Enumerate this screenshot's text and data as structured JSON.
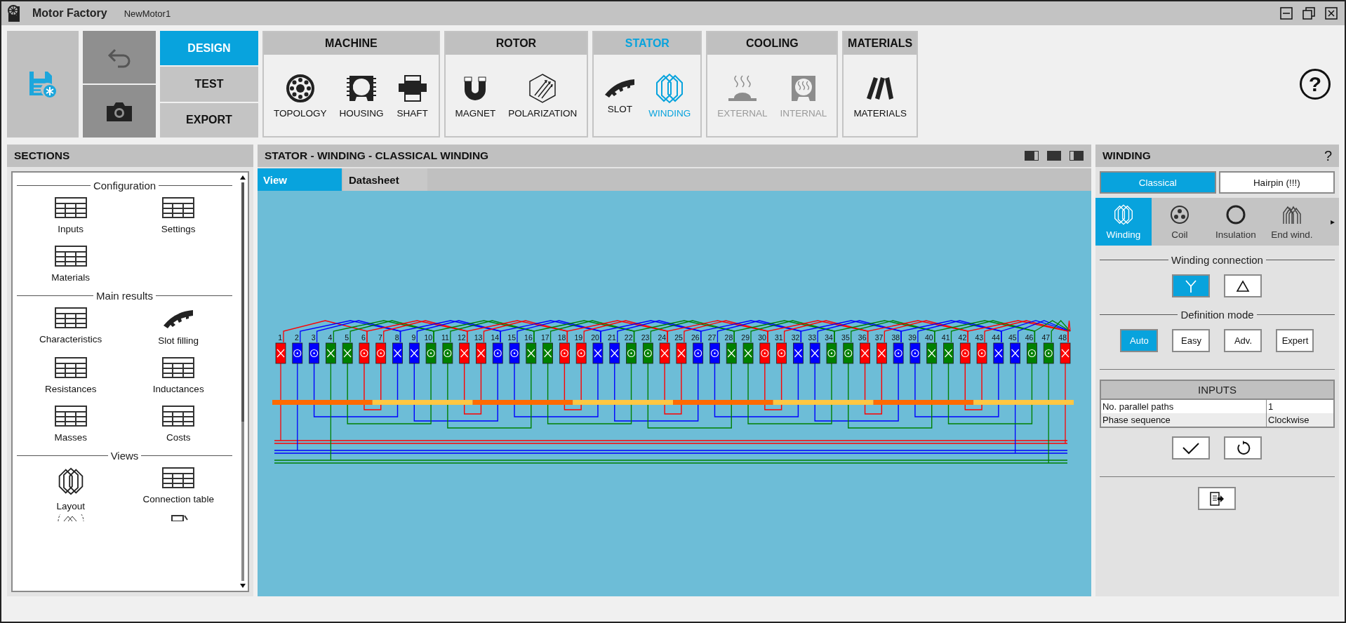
{
  "window": {
    "app_title": "Motor Factory",
    "document": "NewMotor1"
  },
  "mode_buttons": [
    {
      "label": "DESIGN",
      "selected": true
    },
    {
      "label": "TEST",
      "selected": false
    },
    {
      "label": "EXPORT",
      "selected": false
    }
  ],
  "ribbon_groups": [
    {
      "title": "MACHINE",
      "selected": false,
      "items": [
        {
          "label": "TOPOLOGY",
          "kind": "topology",
          "disabled": false,
          "selected": false
        },
        {
          "label": "HOUSING",
          "kind": "housing",
          "disabled": false,
          "selected": false
        },
        {
          "label": "SHAFT",
          "kind": "shaft",
          "disabled": false,
          "selected": false
        }
      ]
    },
    {
      "title": "ROTOR",
      "selected": false,
      "items": [
        {
          "label": "MAGNET",
          "kind": "magnet",
          "disabled": false,
          "selected": false
        },
        {
          "label": "POLARIZATION",
          "kind": "polarization",
          "disabled": false,
          "selected": false
        }
      ]
    },
    {
      "title": "STATOR",
      "selected": true,
      "items": [
        {
          "label": "SLOT",
          "kind": "slot",
          "disabled": false,
          "selected": false
        },
        {
          "label": "WINDING",
          "kind": "winding",
          "disabled": false,
          "selected": true
        }
      ]
    },
    {
      "title": "COOLING",
      "selected": false,
      "items": [
        {
          "label": "EXTERNAL",
          "kind": "external",
          "disabled": true,
          "selected": false
        },
        {
          "label": "INTERNAL",
          "kind": "internal",
          "disabled": true,
          "selected": false
        }
      ]
    },
    {
      "title": "MATERIALS",
      "selected": false,
      "items": [
        {
          "label": "MATERIALS",
          "kind": "materials",
          "disabled": false,
          "selected": false
        }
      ]
    }
  ],
  "help_label": "?",
  "sections": {
    "title": "SECTIONS",
    "groups": [
      {
        "heading": "Configuration",
        "items": [
          {
            "label": "Inputs",
            "kind": "table"
          },
          {
            "label": "Settings",
            "kind": "table"
          },
          {
            "label": "Materials",
            "kind": "table"
          }
        ]
      },
      {
        "heading": "Main results",
        "items": [
          {
            "label": "Characteristics",
            "kind": "table"
          },
          {
            "label": "Slot filling",
            "kind": "slot"
          },
          {
            "label": "Resistances",
            "kind": "table"
          },
          {
            "label": "Inductances",
            "kind": "table"
          },
          {
            "label": "Masses",
            "kind": "table"
          },
          {
            "label": "Costs",
            "kind": "table"
          }
        ]
      },
      {
        "heading": "Views",
        "items": [
          {
            "label": "Layout",
            "kind": "layout"
          },
          {
            "label": "Connection table",
            "kind": "table"
          }
        ]
      }
    ]
  },
  "center": {
    "title": "STATOR - WINDING - CLASSICAL WINDING",
    "tabs": [
      {
        "label": "View",
        "selected": true
      },
      {
        "label": "Datasheet",
        "selected": false
      }
    ],
    "slots": [
      {
        "number": "1",
        "color": "#ff0000",
        "kind": "cross"
      },
      {
        "number": "2",
        "color": "#0000ff",
        "kind": "dot"
      },
      {
        "number": "3",
        "color": "#0000ff",
        "kind": "dot"
      },
      {
        "number": "4",
        "color": "#008000",
        "kind": "cross"
      },
      {
        "number": "5",
        "color": "#008000",
        "kind": "cross"
      },
      {
        "number": "6",
        "color": "#ff0000",
        "kind": "dot"
      },
      {
        "number": "7",
        "color": "#ff0000",
        "kind": "dot"
      },
      {
        "number": "8",
        "color": "#0000ff",
        "kind": "cross"
      },
      {
        "number": "9",
        "color": "#0000ff",
        "kind": "cross"
      },
      {
        "number": "10",
        "color": "#008000",
        "kind": "dot"
      },
      {
        "number": "11",
        "color": "#008000",
        "kind": "dot"
      },
      {
        "number": "12",
        "color": "#ff0000",
        "kind": "cross"
      },
      {
        "number": "13",
        "color": "#ff0000",
        "kind": "cross"
      },
      {
        "number": "14",
        "color": "#0000ff",
        "kind": "dot"
      },
      {
        "number": "15",
        "color": "#0000ff",
        "kind": "dot"
      },
      {
        "number": "16",
        "color": "#008000",
        "kind": "cross"
      },
      {
        "number": "17",
        "color": "#008000",
        "kind": "cross"
      },
      {
        "number": "18",
        "color": "#ff0000",
        "kind": "dot"
      },
      {
        "number": "19",
        "color": "#ff0000",
        "kind": "dot"
      },
      {
        "number": "20",
        "color": "#0000ff",
        "kind": "cross"
      },
      {
        "number": "21",
        "color": "#0000ff",
        "kind": "cross"
      },
      {
        "number": "22",
        "color": "#008000",
        "kind": "dot"
      },
      {
        "number": "23",
        "color": "#008000",
        "kind": "dot"
      },
      {
        "number": "24",
        "color": "#ff0000",
        "kind": "cross"
      },
      {
        "number": "25",
        "color": "#ff0000",
        "kind": "cross"
      },
      {
        "number": "26",
        "color": "#0000ff",
        "kind": "dot"
      },
      {
        "number": "27",
        "color": "#0000ff",
        "kind": "dot"
      },
      {
        "number": "28",
        "color": "#008000",
        "kind": "cross"
      },
      {
        "number": "29",
        "color": "#008000",
        "kind": "cross"
      },
      {
        "number": "30",
        "color": "#ff0000",
        "kind": "dot"
      },
      {
        "number": "31",
        "color": "#ff0000",
        "kind": "dot"
      },
      {
        "number": "32",
        "color": "#0000ff",
        "kind": "cross"
      },
      {
        "number": "33",
        "color": "#0000ff",
        "kind": "cross"
      },
      {
        "number": "34",
        "color": "#008000",
        "kind": "dot"
      },
      {
        "number": "35",
        "color": "#008000",
        "kind": "dot"
      },
      {
        "number": "36",
        "color": "#ff0000",
        "kind": "cross"
      },
      {
        "number": "37",
        "color": "#ff0000",
        "kind": "cross"
      },
      {
        "number": "38",
        "color": "#0000ff",
        "kind": "dot"
      },
      {
        "number": "39",
        "color": "#0000ff",
        "kind": "dot"
      },
      {
        "number": "40",
        "color": "#008000",
        "kind": "cross"
      },
      {
        "number": "41",
        "color": "#008000",
        "kind": "cross"
      },
      {
        "number": "42",
        "color": "#ff0000",
        "kind": "dot"
      },
      {
        "number": "43",
        "color": "#ff0000",
        "kind": "dot"
      },
      {
        "number": "44",
        "color": "#0000ff",
        "kind": "cross"
      },
      {
        "number": "45",
        "color": "#0000ff",
        "kind": "cross"
      },
      {
        "number": "46",
        "color": "#008000",
        "kind": "dot"
      },
      {
        "number": "47",
        "color": "#008000",
        "kind": "dot"
      },
      {
        "number": "48",
        "color": "#ff0000",
        "kind": "cross"
      }
    ]
  },
  "right": {
    "title": "WINDING",
    "help": "?",
    "winding_types": [
      {
        "label": "Classical",
        "selected": true
      },
      {
        "label": "Hairpin (!!!)",
        "selected": false
      }
    ],
    "subtabs": [
      {
        "label": "Winding",
        "kind": "winding",
        "selected": true
      },
      {
        "label": "Coil",
        "kind": "coil",
        "selected": false
      },
      {
        "label": "Insulation",
        "kind": "insulation",
        "selected": false
      },
      {
        "label": "End wind.",
        "kind": "endwind",
        "selected": false
      }
    ],
    "subtab_arrow": "▸",
    "winding_connection": {
      "heading": "Winding connection",
      "options": [
        {
          "kind": "star",
          "selected": true
        },
        {
          "kind": "delta",
          "selected": false
        }
      ]
    },
    "definition_mode": {
      "heading": "Definition mode",
      "options": [
        {
          "label": "Auto",
          "selected": true
        },
        {
          "label": "Easy",
          "selected": false
        },
        {
          "label": "Adv.",
          "selected": false
        },
        {
          "label": "Expert",
          "selected": false
        }
      ]
    },
    "inputs": {
      "title": "INPUTS",
      "rows": [
        {
          "name": "No. parallel paths",
          "value": "1"
        },
        {
          "name": "Phase sequence",
          "value": "Clockwise"
        }
      ]
    }
  }
}
